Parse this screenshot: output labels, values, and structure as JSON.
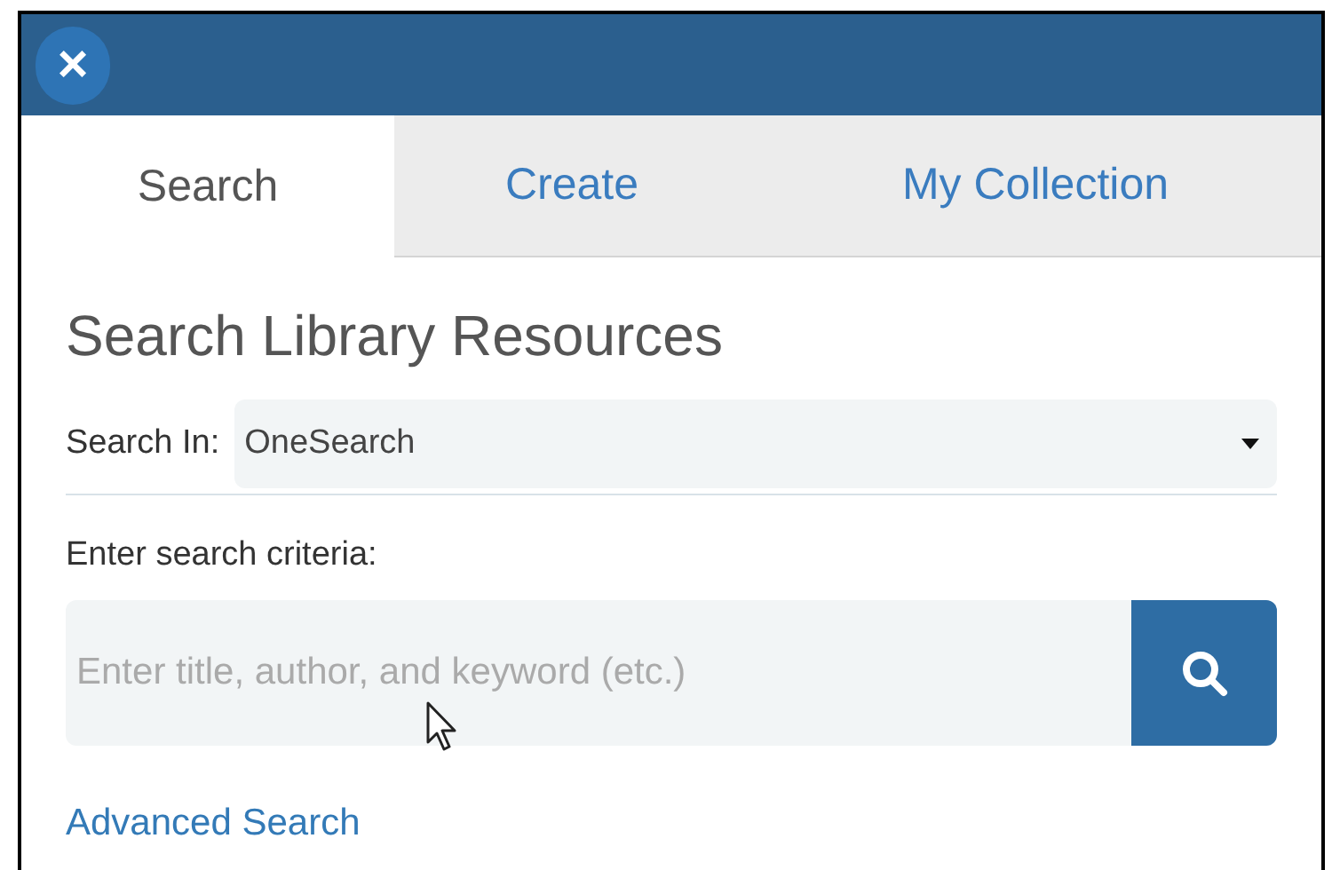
{
  "header": {
    "close_label": "×"
  },
  "tabs": [
    {
      "label": "Search",
      "selected": true
    },
    {
      "label": "Create",
      "selected": false
    },
    {
      "label": "My Collection",
      "selected": false
    }
  ],
  "heading": "Search Library Resources",
  "search_in": {
    "label": "Search In:",
    "value": "OneSearch"
  },
  "criteria": {
    "label": "Enter search criteria:",
    "placeholder": "Enter title, author, and keyword (etc.)"
  },
  "advanced_link": "Advanced Search"
}
